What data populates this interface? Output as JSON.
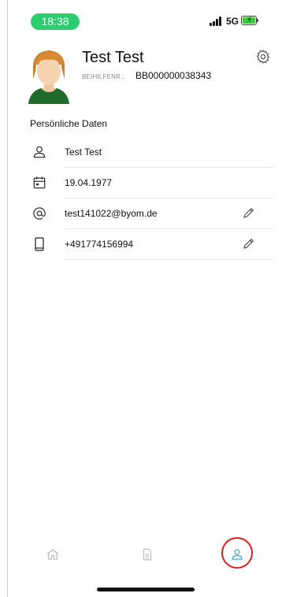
{
  "status_bar": {
    "time": "18:38",
    "network": "5G",
    "battery_state": "charging",
    "time_pill_color": "#2ecc71"
  },
  "profile": {
    "name": "Test Test",
    "id_label": "BEIHILFENR.:",
    "id_value": "BB000000038343"
  },
  "section": {
    "title": "Persönliche Daten"
  },
  "details": [
    {
      "icon": "person-icon",
      "value": "Test Test",
      "editable": false
    },
    {
      "icon": "calendar-icon",
      "value": "19.04.1977",
      "editable": false
    },
    {
      "icon": "at-sign-icon",
      "value": "test141022@byom.de",
      "editable": true
    },
    {
      "icon": "smartphone-icon",
      "value": "+491774156994",
      "editable": true
    }
  ],
  "bottom_nav": {
    "items": [
      {
        "icon": "home-icon",
        "active": false
      },
      {
        "icon": "document-icon",
        "active": false
      },
      {
        "icon": "person-icon",
        "active": true
      }
    ],
    "active_color": "#3aa0dc",
    "inactive_color": "#b8b8b8",
    "highlight_color": "#e02020"
  }
}
